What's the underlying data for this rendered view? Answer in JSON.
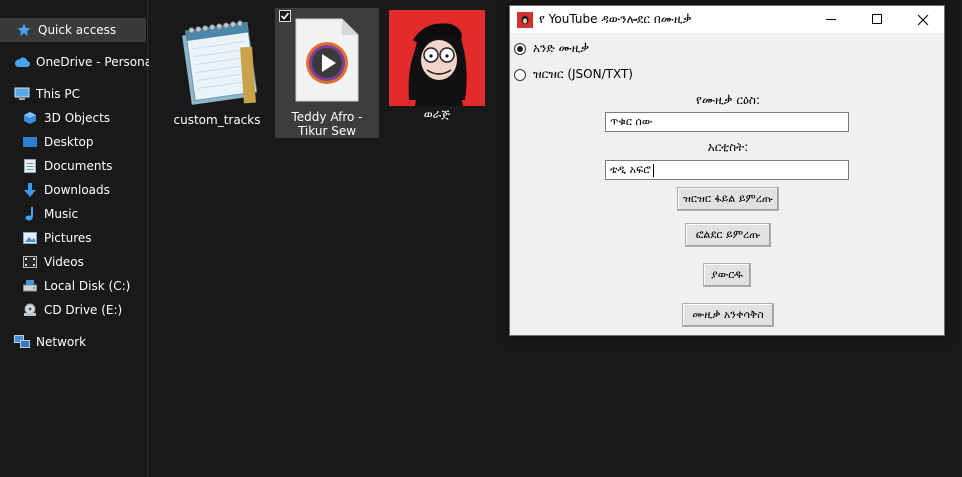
{
  "sidebar": {
    "items": [
      {
        "label": "Quick access",
        "icon": "star-icon"
      },
      {
        "label": "OneDrive - Personal",
        "icon": "cloud-icon"
      },
      {
        "label": "This PC",
        "icon": "computer-icon"
      },
      {
        "label": "3D Objects",
        "icon": "cube-icon"
      },
      {
        "label": "Desktop",
        "icon": "desktop-icon"
      },
      {
        "label": "Documents",
        "icon": "document-icon"
      },
      {
        "label": "Downloads",
        "icon": "download-arrow-icon"
      },
      {
        "label": "Music",
        "icon": "music-note-icon"
      },
      {
        "label": "Pictures",
        "icon": "picture-icon"
      },
      {
        "label": "Videos",
        "icon": "video-icon"
      },
      {
        "label": "Local Disk (C:)",
        "icon": "disk-icon"
      },
      {
        "label": "CD Drive (E:)",
        "icon": "cd-drive-icon"
      },
      {
        "label": "Network",
        "icon": "network-icon"
      }
    ]
  },
  "files": [
    {
      "name": "custom_tracks",
      "icon": "notepad-icon"
    },
    {
      "name": "Teddy Afro - Tikur Sew",
      "icon": "media-file-icon"
    },
    {
      "name": "ወራጅ",
      "icon": "image-thumbnail-icon"
    }
  ],
  "app": {
    "title": "የ YouTube ዳውንሎደር በሙዚቃ",
    "mode_single": "አንድ ሙዚቃ",
    "mode_list": "ዝርዝር (JSON/TXT)",
    "title_label": "የሙዚቃ ርዕስ:",
    "title_value": "ጥቁር ሰው",
    "artist_label": "አርቲስት:",
    "artist_value": "ቴዲ አፍሮ",
    "btn_choose_list": "ዝርዝር ፋይል ይምረጡ",
    "btn_choose_folder": "ፎልደር ይምረጡ",
    "btn_download": "ያውርዱ",
    "btn_normalize": "ሙዚቃ አንቀሳቅስ"
  },
  "colors": {
    "explorer_bg": "#191919",
    "selection": "#3a3a3a",
    "window_bg": "#f0f0f0",
    "accent_blue": "#4aa3f0"
  }
}
